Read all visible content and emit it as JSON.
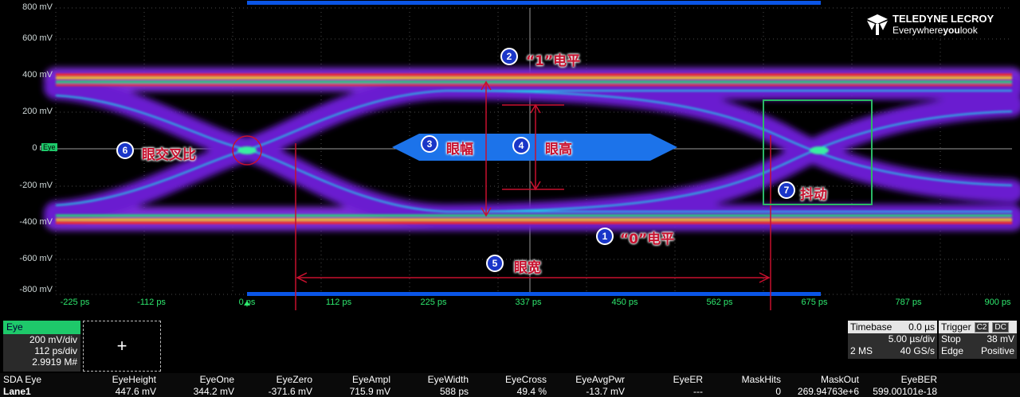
{
  "scope": {
    "y_labels": [
      "800 mV",
      "600 mV",
      "400 mV",
      "200 mV",
      "0 mV",
      "-200 mV",
      "-400 mV",
      "-600 mV",
      "-800 mV"
    ],
    "x_labels": [
      "-225 ps",
      "-112 ps",
      "0 ps",
      "112 ps",
      "225 ps",
      "337 ps",
      "450 ps",
      "562 ps",
      "675 ps",
      "787 ps",
      "900 ps"
    ],
    "trace_tag": "Eye",
    "brand": {
      "name": "TELEDYNE LECROY",
      "tagline_pre": "Everywhere",
      "tagline_bold": "you",
      "tagline_post": "look"
    },
    "colors": {
      "accent_blue": "#0a55e6",
      "annotation_red": "#c8102e",
      "grid": "#555555",
      "axis_green": "#2ee86e"
    }
  },
  "annotations": {
    "a1": {
      "num": "1",
      "text": "“0”电平"
    },
    "a2": {
      "num": "2",
      "text": "“1”电平"
    },
    "a3": {
      "num": "3",
      "text": "眼幅"
    },
    "a4": {
      "num": "4",
      "text": "眼高"
    },
    "a5": {
      "num": "5",
      "text": "眼宽"
    },
    "a6": {
      "num": "6",
      "text": "眼交叉比"
    },
    "a7": {
      "num": "7",
      "text": "抖动"
    }
  },
  "eye_panel": {
    "title": "Eye",
    "vdiv": "200 mV/div",
    "hdiv": "112 ps/div",
    "count": "2.9919 M#"
  },
  "add_panel": {
    "symbol": "+"
  },
  "timebase": {
    "label": "Timebase",
    "delay": "0.0 µs",
    "tdiv": "5.00 µs/div",
    "samples": "2 MS",
    "rate": "40 GS/s"
  },
  "trigger": {
    "label": "Trigger",
    "ch": "C2",
    "coupling": "DC",
    "mode": "Stop",
    "level": "38 mV",
    "type": "Edge",
    "slope": "Positive"
  },
  "measurements": {
    "headers": [
      "SDA Eye",
      "EyeHeight",
      "EyeOne",
      "EyeZero",
      "EyeAmpl",
      "EyeWidth",
      "EyeCross",
      "EyeAvgPwr",
      "EyeER",
      "MaskHits",
      "MaskOut",
      "EyeBER"
    ],
    "values": [
      "Lane1",
      "447.6 mV",
      "344.2 mV",
      "-371.6 mV",
      "715.9 mV",
      "588 ps",
      "49.4 %",
      "-13.7 mV",
      "---",
      "0",
      "269.94763e+6",
      "599.00101e-18"
    ]
  }
}
